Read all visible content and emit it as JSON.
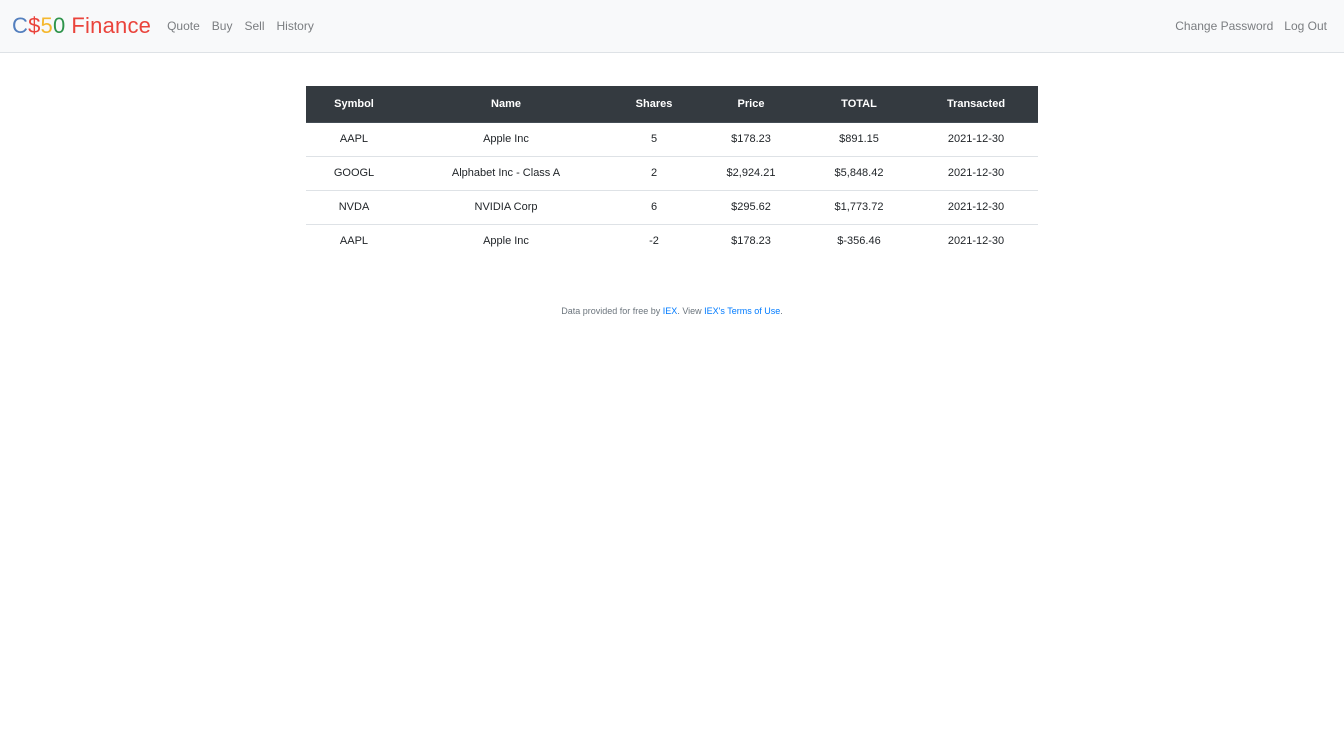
{
  "navbar": {
    "brand": {
      "part1": "C",
      "part2": "$",
      "part3": "5",
      "part4": "0",
      "part5": "Finance"
    },
    "left_links": [
      "Quote",
      "Buy",
      "Sell",
      "History"
    ],
    "right_links": [
      "Change Password",
      "Log Out"
    ]
  },
  "table": {
    "headers": [
      "Symbol",
      "Name",
      "Shares",
      "Price",
      "TOTAL",
      "Transacted"
    ],
    "rows": [
      [
        "AAPL",
        "Apple Inc",
        "5",
        "$178.23",
        "$891.15",
        "2021-12-30"
      ],
      [
        "GOOGL",
        "Alphabet Inc - Class A",
        "2",
        "$2,924.21",
        "$5,848.42",
        "2021-12-30"
      ],
      [
        "NVDA",
        "NVIDIA Corp",
        "6",
        "$295.62",
        "$1,773.72",
        "2021-12-30"
      ],
      [
        "AAPL",
        "Apple Inc",
        "-2",
        "$178.23",
        "$-356.46",
        "2021-12-30"
      ]
    ]
  },
  "footer": {
    "prefix": "Data provided for free by ",
    "link1": "IEX",
    "middle": ". View ",
    "link2": "IEX's Terms of Use",
    "suffix": "."
  },
  "colors": {
    "navbar_bg": "#f8f9fa",
    "table_header_bg": "#343a40",
    "link": "#007bff",
    "brand_blue": "#537fbe",
    "brand_red": "#ea433b",
    "brand_yellow": "#f5b82e",
    "brand_green": "#2e944b"
  }
}
